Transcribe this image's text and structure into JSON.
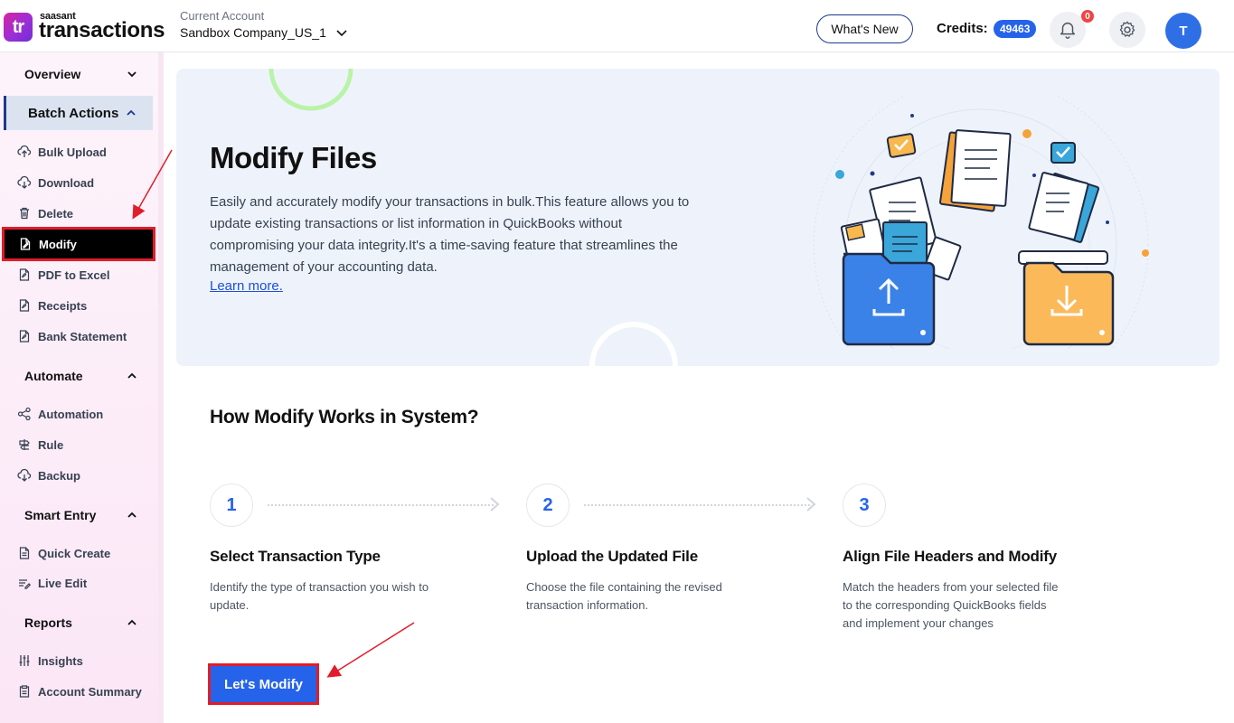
{
  "brand": {
    "small": "saasant",
    "big": "transactions",
    "mark": "tr"
  },
  "header": {
    "account_label": "Current Account",
    "account_name": "Sandbox Company_US_1",
    "whats_new": "What's New",
    "credits_label": "Credits:",
    "credits_value": "49463",
    "notifications_count": "0",
    "avatar_initial": "T"
  },
  "sidebar": {
    "overview": "Overview",
    "batch_actions": "Batch Actions",
    "batch_items": [
      "Bulk Upload",
      "Download",
      "Delete",
      "Modify",
      "PDF to Excel",
      "Receipts",
      "Bank Statement"
    ],
    "automate": "Automate",
    "automate_items": [
      "Automation",
      "Rule",
      "Backup"
    ],
    "smart_entry": "Smart Entry",
    "smart_items": [
      "Quick Create",
      "Live Edit"
    ],
    "reports": "Reports",
    "report_items": [
      "Insights",
      "Account Summary"
    ]
  },
  "hero": {
    "title": "Modify Files",
    "description": "Easily and accurately modify your transactions in bulk.This feature allows you to update existing transactions or list information in QuickBooks without compromising your data integrity.It's a time-saving feature that streamlines the management of your accounting data.",
    "link": "Learn more."
  },
  "how": {
    "title": "How Modify Works in System?",
    "steps": [
      {
        "num": "1",
        "title": "Select Transaction Type",
        "desc": "Identify the type of transaction you wish to update."
      },
      {
        "num": "2",
        "title": "Upload the Updated File",
        "desc": "Choose the file containing the revised transaction information."
      },
      {
        "num": "3",
        "title": "Align File Headers and Modify",
        "desc": "Match the headers from your selected file to the corresponding QuickBooks fields and implement your changes"
      }
    ]
  },
  "cta": "Let's Modify",
  "colors": {
    "primary": "#2563eb",
    "highlight": "#e11d2a",
    "navy": "#1e3a8a"
  }
}
